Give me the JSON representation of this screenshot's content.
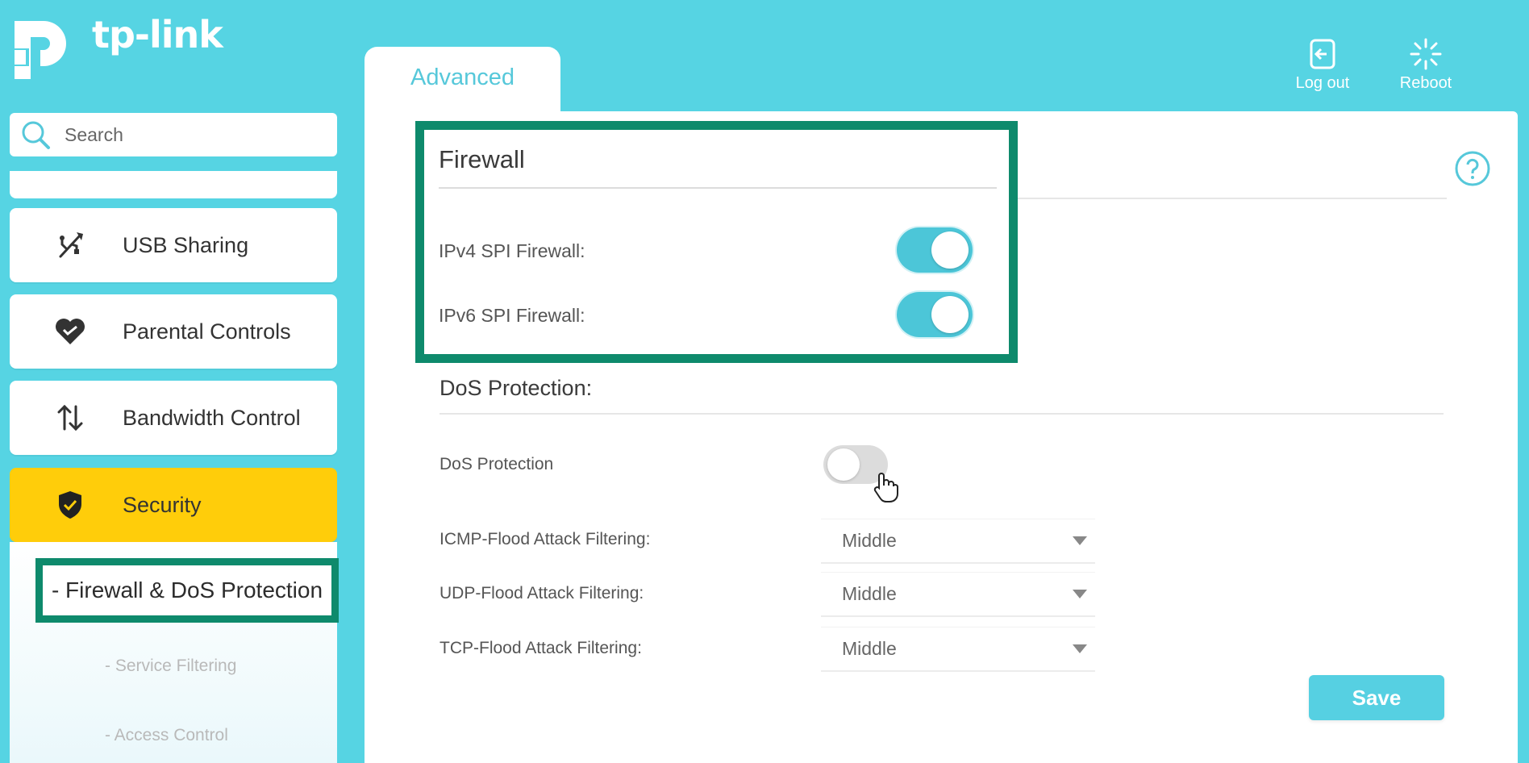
{
  "brand": {
    "name": "tp-link",
    "accent_color": "#56d4e3",
    "highlight_color": "#0e8a6c",
    "active_nav_color": "#ffcd0a"
  },
  "header": {
    "logout_label": "Log out",
    "logout_icon": "logout-icon",
    "reboot_label": "Reboot",
    "reboot_icon": "reboot-icon"
  },
  "sidebar": {
    "search_placeholder": "Search",
    "items": [
      {
        "label": "USB Sharing",
        "icon": "usb-icon"
      },
      {
        "label": "Parental Controls",
        "icon": "heart-icon"
      },
      {
        "label": "Bandwidth Control",
        "icon": "up-down-arrows-icon"
      },
      {
        "label": "Security",
        "icon": "shield-check-icon",
        "active": true
      }
    ],
    "subitems": [
      {
        "label": "- Firewall & DoS Protection",
        "active": true
      },
      {
        "label": "- Service Filtering"
      },
      {
        "label": "- Access Control"
      }
    ]
  },
  "main": {
    "tab_label": "Advanced",
    "firewall": {
      "title": "Firewall",
      "ipv4_label": "IPv4 SPI Firewall:",
      "ipv4_enabled": true,
      "ipv6_label": "IPv6 SPI Firewall:",
      "ipv6_enabled": true
    },
    "dos": {
      "section_title": "DoS Protection:",
      "toggle_label": "DoS Protection",
      "enabled": false,
      "icmp_label": "ICMP-Flood Attack Filtering:",
      "icmp_value": "Middle",
      "udp_label": "UDP-Flood Attack Filtering:",
      "udp_value": "Middle",
      "tcp_label": "TCP-Flood Attack Filtering:",
      "tcp_value": "Middle"
    },
    "save_label": "Save"
  }
}
